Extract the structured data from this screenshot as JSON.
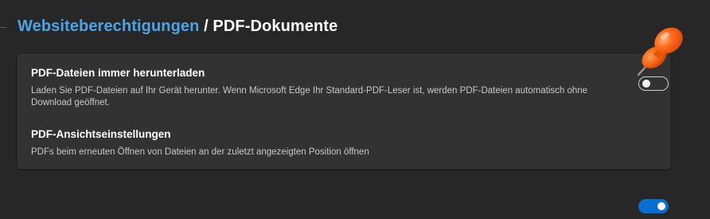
{
  "header": {
    "breadcrumb_parent": "Websiteberechtigungen",
    "breadcrumb_separator": " / ",
    "breadcrumb_current": "PDF-Dokumente"
  },
  "settings": [
    {
      "title": "PDF-Dateien immer herunterladen",
      "description": "Laden Sie PDF-Dateien auf Ihr Gerät herunter. Wenn Microsoft Edge Ihr Standard-PDF-Leser ist, werden PDF-Dateien automatisch ohne Download geöffnet.",
      "enabled": false
    },
    {
      "title": "PDF-Ansichtseinstellungen",
      "description": "PDFs beim erneuten Öffnen von Dateien an der zuletzt angezeigten Position öffnen",
      "enabled": true
    }
  ],
  "colors": {
    "background": "#272727",
    "card": "#323232",
    "link": "#4ea3e6",
    "toggle_on": "#0a6ed1",
    "pushpin": "#ff6a1a"
  },
  "icons": {
    "overlay": "pushpin-icon"
  }
}
